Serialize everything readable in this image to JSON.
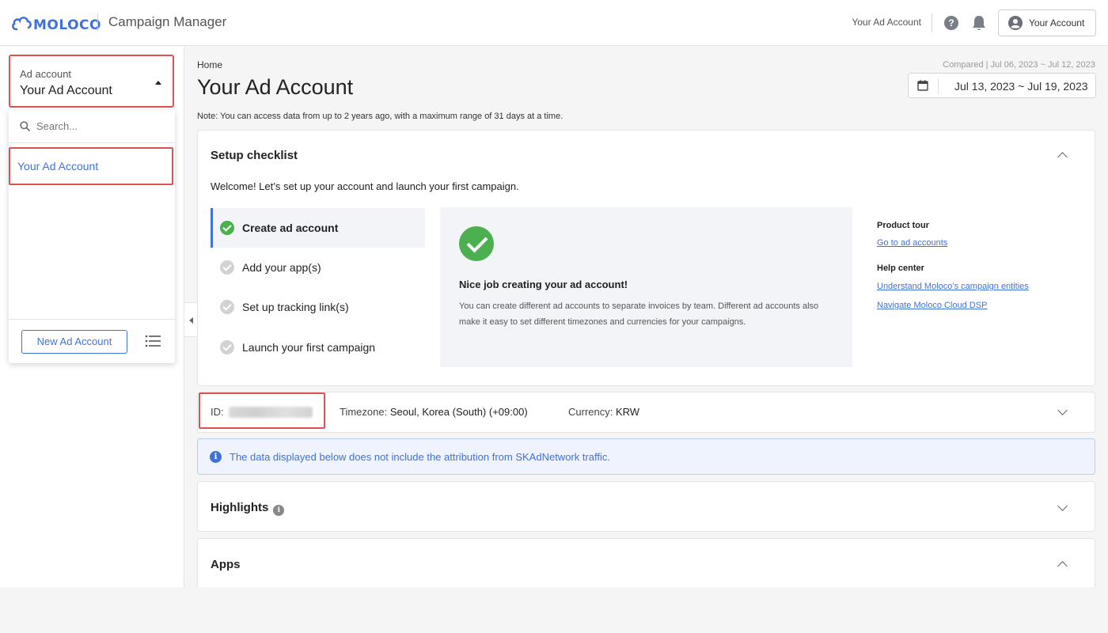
{
  "header": {
    "logo_text": "MOLOCO",
    "app_title": "Campaign Manager",
    "account_text": "Your Ad Account",
    "help_glyph": "?",
    "account_button": "Your Account",
    "icons": [
      "cloud-logo-icon",
      "help-icon",
      "bell-icon",
      "user-icon"
    ]
  },
  "sidebar": {
    "select_caption": "Ad account",
    "select_value": "Your Ad Account",
    "dropdown": {
      "search_placeholder": "Search...",
      "items": [
        {
          "label": "Your Ad Account"
        }
      ],
      "new_button": "New Ad Account"
    }
  },
  "main": {
    "breadcrumb": "Home",
    "title": "Your Ad Account",
    "note": "Note: You can access data from up to 2 years ago, with a maximum range of 31 days at a time.",
    "compared": "Compared | Jul 06, 2023 ~ Jul 12, 2023",
    "date_range": "Jul 13, 2023 ~ Jul 19, 2023",
    "setup": {
      "title": "Setup checklist",
      "welcome": "Welcome! Let’s set up your account and launch your first campaign.",
      "steps": [
        {
          "label": "Create ad account",
          "done": true
        },
        {
          "label": "Add your app(s)",
          "done": false
        },
        {
          "label": "Set up tracking link(s)",
          "done": false
        },
        {
          "label": "Launch your first campaign",
          "done": false
        }
      ],
      "detail_title": "Nice job creating your ad account!",
      "detail_body": "You can create different ad accounts to separate invoices by team. Different ad accounts also make it easy to set different timezones and currencies for your campaigns.",
      "product_tour_header": "Product tour",
      "product_tour_link": "Go to ad accounts",
      "help_center_header": "Help center",
      "help_links": [
        "Understand Moloco’s campaign entities",
        "Navigate Moloco Cloud DSP"
      ]
    },
    "account_info": {
      "id_label": "ID:",
      "timezone_label": "Timezone:",
      "timezone_value": "Seoul, Korea (South) (+09:00)",
      "currency_label": "Currency:",
      "currency_value": "KRW"
    },
    "banner": {
      "glyph": "i",
      "text": "The data displayed below does not include the attribution from SKAdNetwork traffic."
    },
    "highlights_title": "Highlights",
    "highlights_glyph": "i",
    "apps_title": "Apps"
  },
  "colors": {
    "accent": "#3f72d9",
    "highlight_border": "#e05252",
    "success": "#4caf50"
  }
}
